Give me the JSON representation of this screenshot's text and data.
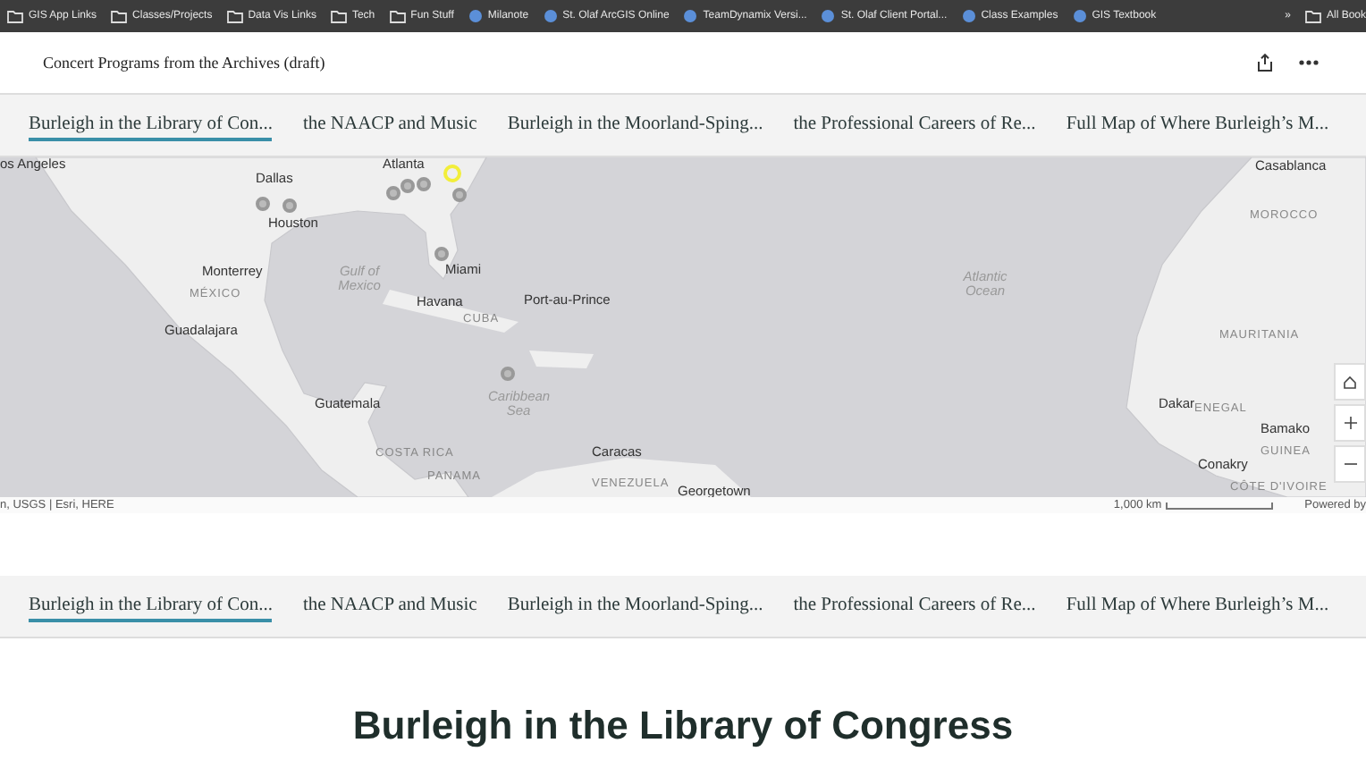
{
  "bookmarks": [
    {
      "label": "GIS App Links",
      "kind": "folder"
    },
    {
      "label": "Classes/Projects",
      "kind": "folder"
    },
    {
      "label": "Data Vis Links",
      "kind": "folder"
    },
    {
      "label": "Tech",
      "kind": "folder"
    },
    {
      "label": "Fun Stuff",
      "kind": "folder"
    },
    {
      "label": "Milanote",
      "kind": "site"
    },
    {
      "label": "St. Olaf ArcGIS Online",
      "kind": "site"
    },
    {
      "label": "TeamDynamix Versi...",
      "kind": "site"
    },
    {
      "label": "St. Olaf Client Portal...",
      "kind": "site"
    },
    {
      "label": "Class Examples",
      "kind": "site"
    },
    {
      "label": "GIS Textbook",
      "kind": "site"
    }
  ],
  "bookmarks_more": "»",
  "bookmarks_all": "All Book",
  "header": {
    "title": "Concert Programs from the Archives (draft)"
  },
  "tabs": [
    {
      "label": "Burleigh in the Library of Con...",
      "selected": true
    },
    {
      "label": "the NAACP and Music",
      "selected": false
    },
    {
      "label": "Burleigh in the Moorland-Sping...",
      "selected": false
    },
    {
      "label": "the Professional Careers of Re...",
      "selected": false
    },
    {
      "label": "Full Map of Where Burleigh’s M...",
      "selected": false
    }
  ],
  "map": {
    "labels": [
      {
        "text": "os Angeles",
        "kind": "city"
      },
      {
        "text": "Dallas",
        "kind": "city"
      },
      {
        "text": "Houston",
        "kind": "city"
      },
      {
        "text": "Atlanta",
        "kind": "city"
      },
      {
        "text": "Monterrey",
        "kind": "city"
      },
      {
        "text": "MÉXICO",
        "kind": "country"
      },
      {
        "text": "Gulf of Mexico",
        "kind": "water"
      },
      {
        "text": "Miami",
        "kind": "city"
      },
      {
        "text": "Havana",
        "kind": "city"
      },
      {
        "text": "CUBA",
        "kind": "country"
      },
      {
        "text": "Guadalajara",
        "kind": "city"
      },
      {
        "text": "Port-au-Prince",
        "kind": "city"
      },
      {
        "text": "Guatemala",
        "kind": "city"
      },
      {
        "text": "Caribbean Sea",
        "kind": "water"
      },
      {
        "text": "COSTA RICA",
        "kind": "country"
      },
      {
        "text": "PANAMA",
        "kind": "country"
      },
      {
        "text": "Caracas",
        "kind": "city"
      },
      {
        "text": "VENEZUELA",
        "kind": "country"
      },
      {
        "text": "Georgetown",
        "kind": "city"
      },
      {
        "text": "Casablanca",
        "kind": "city"
      },
      {
        "text": "MOROCCO",
        "kind": "country"
      },
      {
        "text": "Atlantic Ocean",
        "kind": "water"
      },
      {
        "text": "MAURITANIA",
        "kind": "country"
      },
      {
        "text": "Dakar",
        "kind": "city"
      },
      {
        "text": "ENEGAL",
        "kind": "country"
      },
      {
        "text": "Bamako",
        "kind": "city"
      },
      {
        "text": "GUINEA",
        "kind": "country"
      },
      {
        "text": "Conakry",
        "kind": "city"
      },
      {
        "text": "CÔTE D'IVOIRE",
        "kind": "country"
      }
    ],
    "markers": [
      {
        "selected": false
      },
      {
        "selected": false
      },
      {
        "selected": false
      },
      {
        "selected": false
      },
      {
        "selected": false
      },
      {
        "selected": true
      },
      {
        "selected": false
      },
      {
        "selected": false
      },
      {
        "selected": false
      }
    ],
    "attribution": "n, USGS | Esri, HERE",
    "scale": "1,000 km",
    "powered": "Powered by"
  },
  "tabs_bottom": [
    {
      "label": "Burleigh in the Library of Con...",
      "selected": true
    },
    {
      "label": "the NAACP and Music",
      "selected": false
    },
    {
      "label": "Burleigh in the Moorland-Sping...",
      "selected": false
    },
    {
      "label": "the Professional Careers of Re...",
      "selected": false
    },
    {
      "label": "Full Map of Where Burleigh’s M...",
      "selected": false
    }
  ],
  "section_title": "Burleigh in the Library of Congress"
}
